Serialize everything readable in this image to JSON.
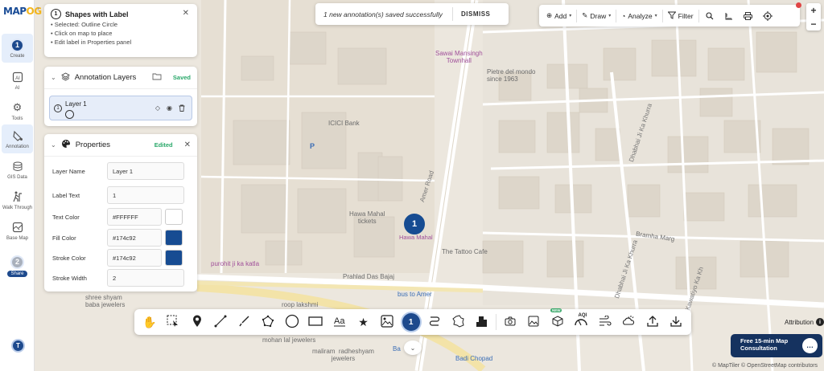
{
  "logo": {
    "text_a": "MAP",
    "text_b": "OG"
  },
  "rail": {
    "create": {
      "num": "1",
      "label": "Create"
    },
    "ai": {
      "label": "AI"
    },
    "tools": {
      "label": "Tools"
    },
    "annotation": {
      "label": "Annotation"
    },
    "gis": {
      "label": "GIS Data"
    },
    "walk": {
      "label": "Walk Through"
    },
    "basemap": {
      "label": "Base Map"
    },
    "share": {
      "num": "2",
      "label": "Share"
    },
    "avatar": "T"
  },
  "instructions": {
    "num": "1",
    "title": "Shapes with Label",
    "lines": [
      "• Selected: Outline Circle",
      "• Click on map to place",
      "• Edit label in Properties panel"
    ]
  },
  "layers": {
    "title": "Annotation Layers",
    "status": "Saved",
    "items": [
      {
        "num": "1",
        "name": "Layer 1"
      }
    ]
  },
  "properties": {
    "title": "Properties",
    "status": "Edited",
    "layer_name": {
      "label": "Layer Name",
      "value": "Layer 1"
    },
    "label_text": {
      "label": "Label Text",
      "value": "1"
    },
    "text_color": {
      "label": "Text Color",
      "value": "#FFFFFF",
      "swatch": "#FFFFFF"
    },
    "fill_color": {
      "label": "Fill Color",
      "value": "#174c92",
      "swatch": "#174c92"
    },
    "stroke_color": {
      "label": "Stroke Color",
      "value": "#174c92",
      "swatch": "#174c92"
    },
    "stroke_width": {
      "label": "Stroke Width",
      "value": "2"
    }
  },
  "toast": {
    "message": "1 new annotation(s) saved successfully",
    "action": "DISMISS"
  },
  "topbar": {
    "add": "Add",
    "draw": "Draw",
    "analyze": "Analyze",
    "filter": "Filter"
  },
  "zoom": {
    "in": "+",
    "out": "−"
  },
  "map_labels": {
    "sawai": "Sawai Mansingh\nTownhall",
    "pietre": "Pietre del mondo\nsince 1963",
    "icici": "ICICI Bank",
    "parking": "P",
    "hawa_tickets": "Hawa Mahal\ntickets",
    "amer_road": "Amer Road",
    "dhabhai1": "Dhabhai Ji Ka Khurra",
    "dhabhai2": "Dhabhai Ji Ka Khurra",
    "bramha": "Bramha Marg",
    "kawatiyo": "Kawatiyo Ka Kh",
    "purohit": "purohit ji ka katla",
    "tattoo": "The Tattoo Cafe",
    "prahlad": "Prahlad Das Bajaj",
    "shree": "shree shyam\nbaba jewelers",
    "roop": "roop lakshmi",
    "bus": "bus to Amer",
    "mohan": "mohan lal jewelers",
    "malirām": "maliram  radheshyam\njewelers",
    "badi": "Badi Chopad",
    "ba": "Ba"
  },
  "marker": {
    "text": "1",
    "label": "Hawa Mahal"
  },
  "consult": {
    "line1": "Free 15-min Map",
    "line2": "Consultation"
  },
  "attribution": "Attribution",
  "credits": "© MapTiler © OpenStreetMap contributors",
  "new_badge": "NEW",
  "ai_tag": "AQI"
}
